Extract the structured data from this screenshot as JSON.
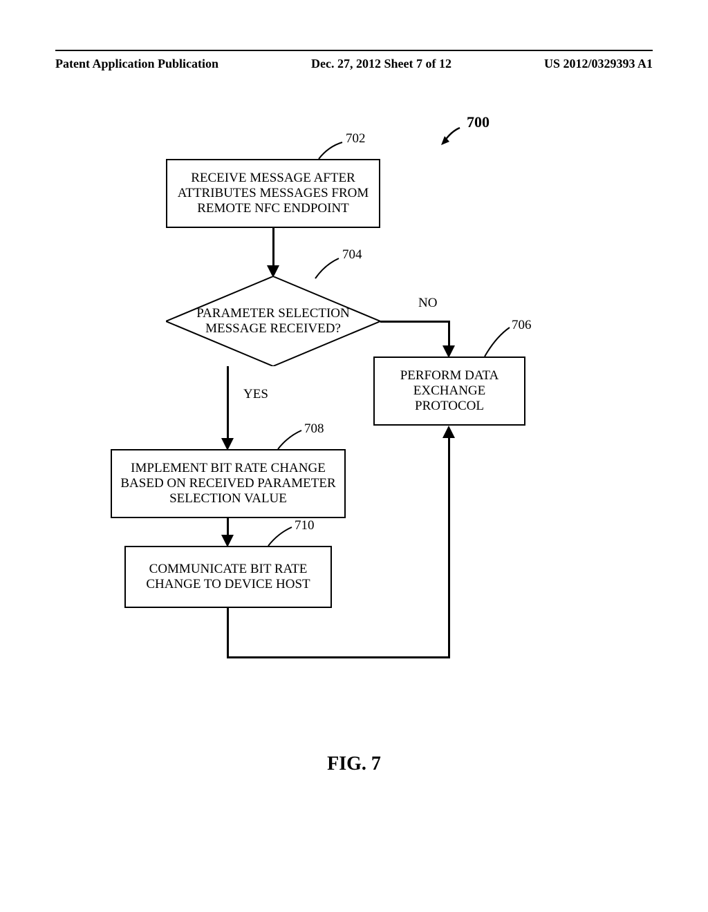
{
  "header": {
    "left": "Patent Application Publication",
    "center": "Dec. 27, 2012  Sheet 7 of 12",
    "right": "US 2012/0329393 A1"
  },
  "refs": {
    "main": "700",
    "box702": "702",
    "diamond704": "704",
    "box706": "706",
    "box708": "708",
    "box710": "710"
  },
  "boxes": {
    "box702": "RECEIVE MESSAGE AFTER ATTRIBUTES MESSAGES FROM REMOTE NFC ENDPOINT",
    "diamond704": "PARAMETER SELECTION MESSAGE RECEIVED?",
    "box706": "PERFORM DATA EXCHANGE PROTOCOL",
    "box708": "IMPLEMENT BIT RATE CHANGE BASED ON RECEIVED PARAMETER SELECTION VALUE",
    "box710": "COMMUNICATE BIT RATE CHANGE TO DEVICE HOST"
  },
  "labels": {
    "no": "NO",
    "yes": "YES"
  },
  "figure": "FIG. 7"
}
